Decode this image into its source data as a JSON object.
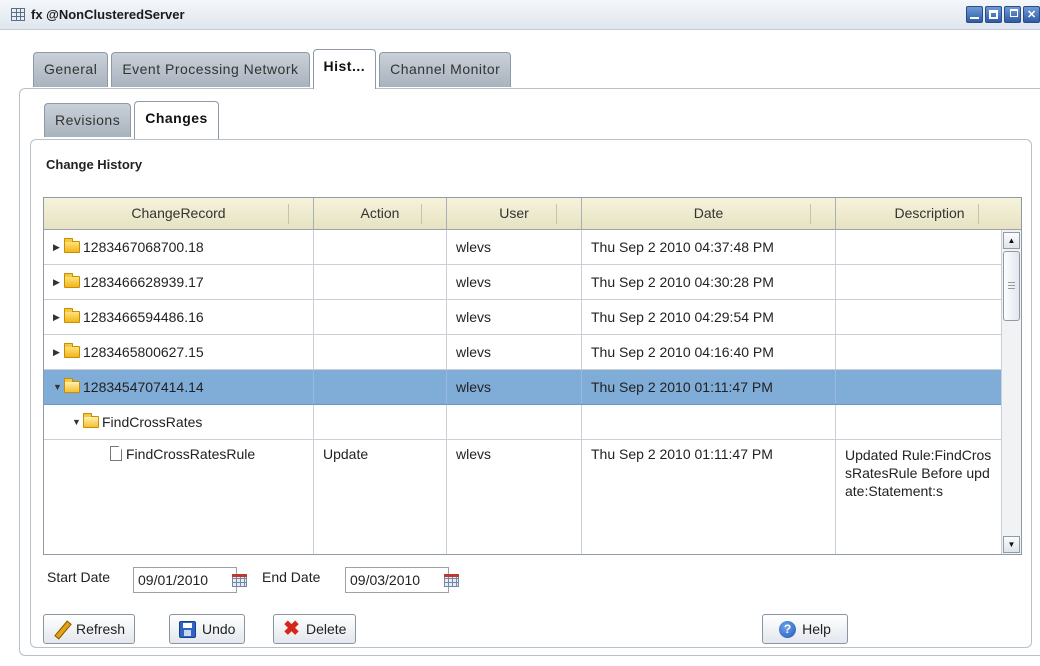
{
  "window": {
    "title": "fx @NonClusteredServer"
  },
  "outer_tabs": [
    "General",
    "Event Processing Network",
    "Hist...",
    "Channel Monitor"
  ],
  "inner_tabs": [
    "Revisions",
    "Changes"
  ],
  "section_title": "Change History",
  "table": {
    "columns": [
      "ChangeRecord",
      "Action",
      "User",
      "Date",
      "Description"
    ],
    "rows": [
      {
        "record": "1283467068700.18",
        "action": "",
        "user": "wlevs",
        "date": "Thu Sep 2 2010 04:37:48 PM",
        "description": ""
      },
      {
        "record": "1283466628939.17",
        "action": "",
        "user": "wlevs",
        "date": "Thu Sep 2 2010 04:30:28 PM",
        "description": ""
      },
      {
        "record": "1283466594486.16",
        "action": "",
        "user": "wlevs",
        "date": "Thu Sep 2 2010 04:29:54 PM",
        "description": ""
      },
      {
        "record": "1283465800627.15",
        "action": "",
        "user": "wlevs",
        "date": "Thu Sep 2 2010 04:16:40 PM",
        "description": ""
      },
      {
        "record": "1283454707414.14",
        "action": "",
        "user": "wlevs",
        "date": "Thu Sep 2 2010 01:11:47 PM",
        "description": "",
        "selected": true
      },
      {
        "record": "FindCrossRates",
        "action": "",
        "user": "",
        "date": "",
        "description": ""
      },
      {
        "record": "FindCrossRatesRule",
        "action": "Update",
        "user": "wlevs",
        "date": "Thu Sep 2 2010 01:11:47 PM",
        "description": "Updated Rule:FindCrossRatesRule Before update:Statement:s"
      }
    ]
  },
  "filters": {
    "start_label": "Start Date",
    "start_value": "09/01/2010",
    "end_label": "End Date",
    "end_value": "09/03/2010"
  },
  "buttons": {
    "refresh": "Refresh",
    "undo": "Undo",
    "delete": "Delete",
    "help": "Help"
  },
  "colors": {
    "selected_row": "#80acd8",
    "header_bg": "#f0edd3",
    "accent": "#2f5ca5"
  }
}
